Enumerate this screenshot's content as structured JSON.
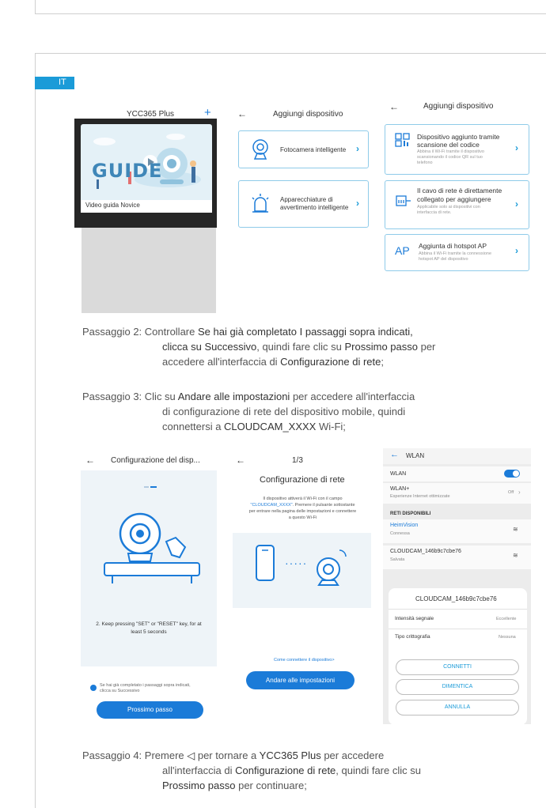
{
  "language_tag": "IT",
  "screen1": {
    "title": "YCC365 Plus",
    "plus_icon": "plus-icon",
    "guide_word": "GUIDE",
    "caption": "Video guida Novice"
  },
  "screen2": {
    "title": "Aggiungi dispositivo",
    "options": [
      {
        "label": "Fotocamera intelligente",
        "icon": "camera-icon"
      },
      {
        "label_line1": "Apparecchiature di",
        "label_line2": "avvertimento intelligente",
        "icon": "alarm-icon"
      }
    ]
  },
  "screen3": {
    "title": "Aggiungi dispositivo",
    "options": [
      {
        "title_line1": "Dispositivo aggiunto tramite",
        "title_line2": "scansione del codice",
        "desc_line1": "Abbina il Wi-Fi tramite il dispositivo",
        "desc_line2": "scansionando il codice QR sul tuo",
        "desc_line3": "telefono",
        "icon": "qr-code-icon"
      },
      {
        "title_line1": "Il cavo di rete è direttamente",
        "title_line2": "collegato per aggiungere",
        "desc_line1": "Applicabile solo ai dispositivi con",
        "desc_line2": "interfaccia di rete.",
        "icon": "ethernet-icon"
      },
      {
        "title_line1": "Aggiunta di hotspot AP",
        "desc_line1": "Abbina il Wi-Fi tramite la connessione",
        "desc_line2": "hotspot AP del dispositivo",
        "icon_text": "AP"
      }
    ]
  },
  "steps": {
    "step2": {
      "prefix": "Passaggio 2: Controllare ",
      "bold1": "Se hai già completato I passaggi sopra indicati,",
      "bold1b": "clicca su Successivo",
      "mid1": ", quindi fare clic su ",
      "bold2": "Prossimo passo",
      "mid2": " per",
      "line3a": "accedere all'interfaccia di ",
      "bold3": "Configurazione di rete",
      "end": ";"
    },
    "step3": {
      "prefix": "Passaggio 3: Clic su ",
      "bold1": "Andare alle impostazioni",
      "mid1": " per accedere all'interfaccia",
      "line2": "di configurazione di rete del dispositivo mobile, quindi",
      "line3a": "connettersi a ",
      "bold2": "CLOUDCAM_XXXX",
      "end": " Wi-Fi;"
    },
    "step4": {
      "prefix": "Passaggio 4: Premere ",
      "mid1": " per tornare a ",
      "bold1": "YCC365 Plus",
      "mid2": " per accedere",
      "line2a": "all'interfaccia di ",
      "bold2": "Configurazione di rete",
      "mid3": ", quindi fare clic su",
      "bold3": "Prossimo passo",
      "end": " per continuare;"
    }
  },
  "screen4": {
    "title": "Configurazione del disp...",
    "instruction_line1": "2. Keep pressing \"SET\" or \"RESET\" key, for at",
    "instruction_line2": "least 5 seconds",
    "checkbox_line1": "Se hai già completato i passaggi sopra indicati,",
    "checkbox_line2": "clicca su Successivo",
    "button": "Prossimo passo"
  },
  "screen5": {
    "page": "1/3",
    "title": "Configurazione di rete",
    "body_line1": "Il dispositivo attiverà il Wi-Fi con il campo",
    "body_line2_link": "\"CLOUDCAM_XXXX\"",
    "body_line2_rest": ". Premere il pulsante sottostante",
    "body_line3": "per entrare nella pagina delle impostazioni e connettere",
    "body_line4": "a questo Wi-Fi",
    "ellipsis": "·····",
    "help_link": "Come connettere il dispositivo>",
    "button": "Andare alle impostazioni"
  },
  "screen6": {
    "header": "WLAN",
    "wlan_label": "WLAN",
    "wlanplus_label": "WLAN+",
    "wlanplus_sub": "Esperienze Internet ottimizzate",
    "wlanplus_state": "Off",
    "section": "RETI DISPONIBILI",
    "networks": [
      {
        "name": "HeimVision",
        "status": "Connessa"
      },
      {
        "name": "CLOUDCAM_146b9c7cbe76",
        "status": "Salvata"
      }
    ],
    "dialog": {
      "title": "CLOUDCAM_146b9c7cbe76",
      "signal_label": "Intensità segnale",
      "signal_value": "Eccellente",
      "crypto_label": "Tipo crittografia",
      "crypto_value": "Nessuna",
      "btn_connect": "CONNETTI",
      "btn_forget": "DIMENTICA",
      "btn_cancel": "ANNULLA"
    }
  }
}
